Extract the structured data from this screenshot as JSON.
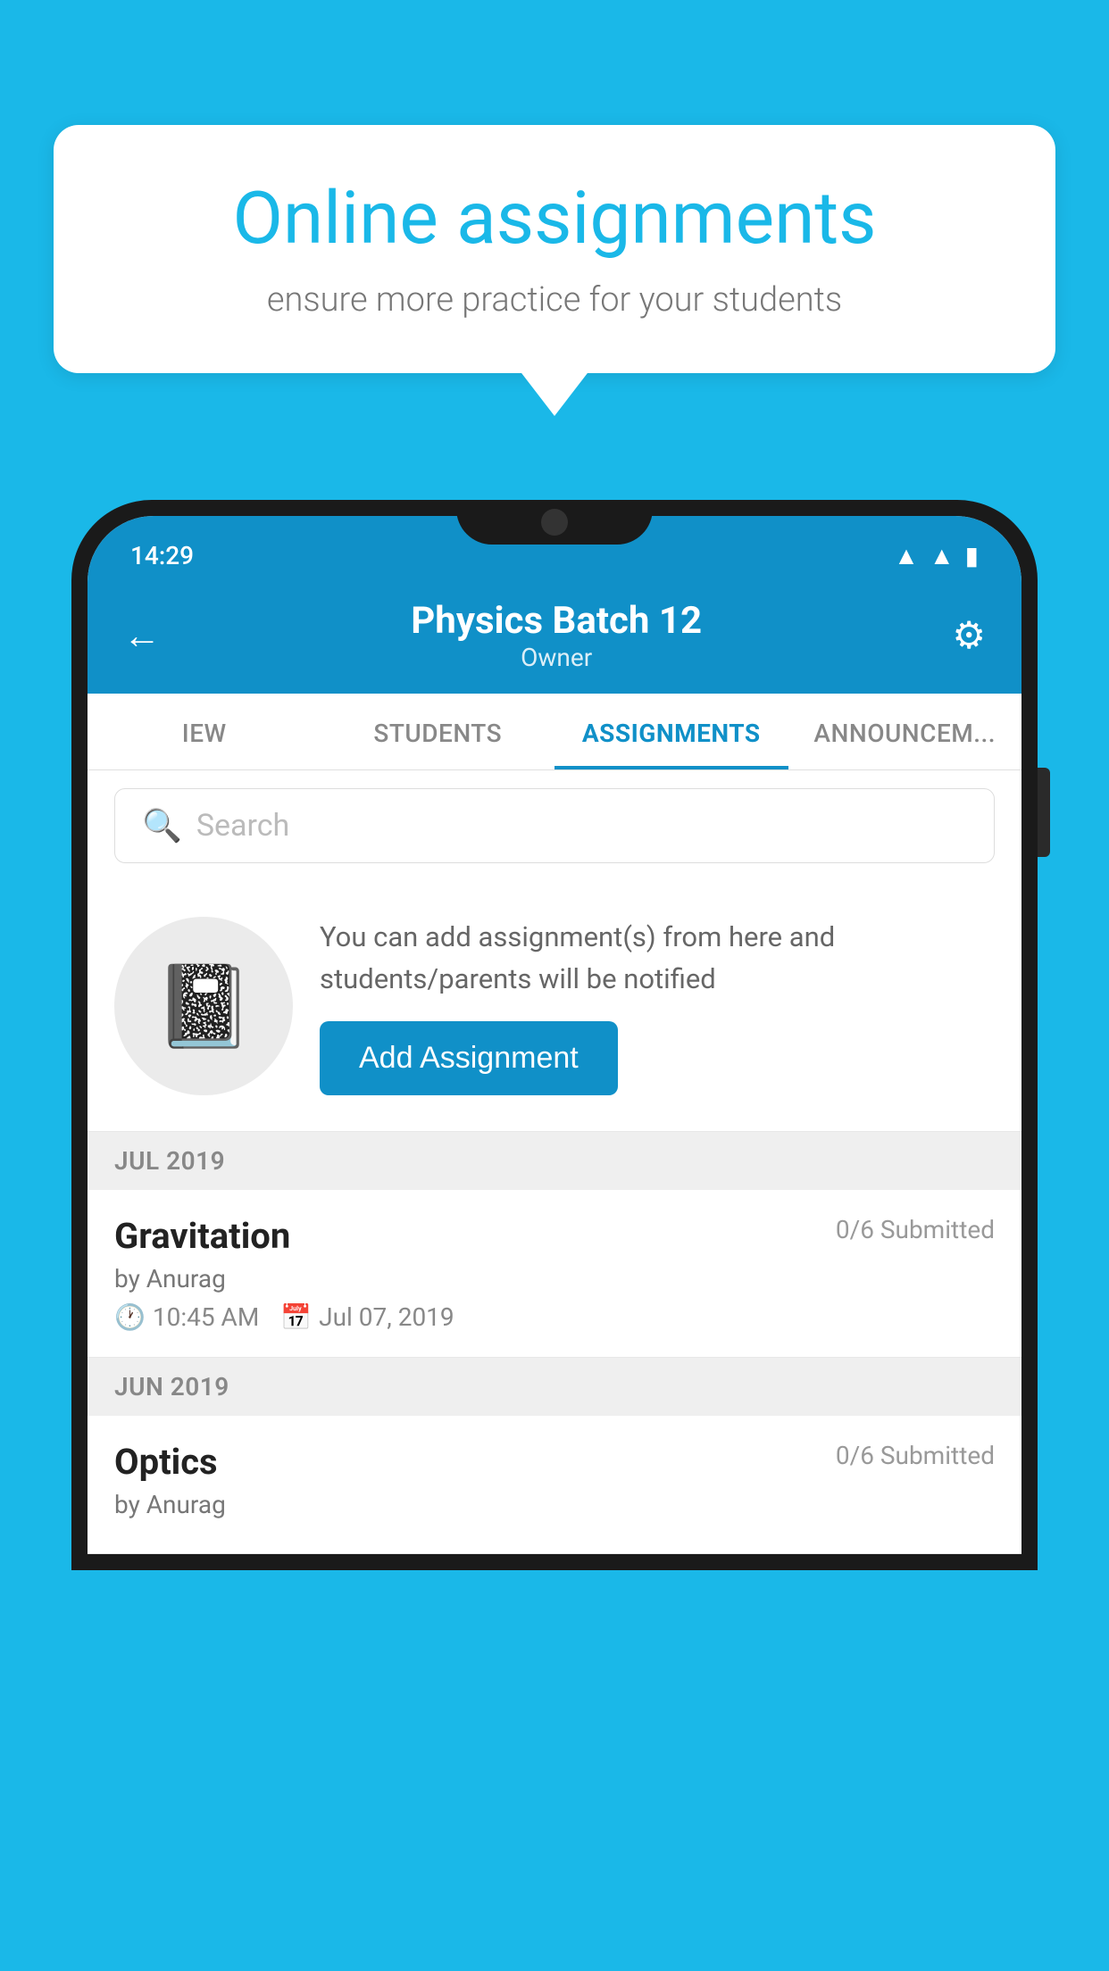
{
  "background_color": "#1ab8e8",
  "speech_bubble": {
    "title": "Online assignments",
    "subtitle": "ensure more practice for your students"
  },
  "status_bar": {
    "time": "14:29",
    "icons": [
      "wifi",
      "signal",
      "battery"
    ]
  },
  "header": {
    "title": "Physics Batch 12",
    "subtitle": "Owner",
    "back_label": "←",
    "gear_label": "⚙"
  },
  "tabs": [
    {
      "label": "IEW",
      "active": false
    },
    {
      "label": "STUDENTS",
      "active": false
    },
    {
      "label": "ASSIGNMENTS",
      "active": true
    },
    {
      "label": "ANNOUNCEM...",
      "active": false
    }
  ],
  "search": {
    "placeholder": "Search"
  },
  "add_area": {
    "description": "You can add assignment(s) from here and students/parents will be notified",
    "button_label": "Add Assignment"
  },
  "sections": [
    {
      "label": "JUL 2019",
      "assignments": [
        {
          "name": "Gravitation",
          "submitted": "0/6 Submitted",
          "by": "by Anurag",
          "time": "10:45 AM",
          "date": "Jul 07, 2019"
        }
      ]
    },
    {
      "label": "JUN 2019",
      "assignments": [
        {
          "name": "Optics",
          "submitted": "0/6 Submitted",
          "by": "by Anurag",
          "time": "",
          "date": ""
        }
      ]
    }
  ]
}
